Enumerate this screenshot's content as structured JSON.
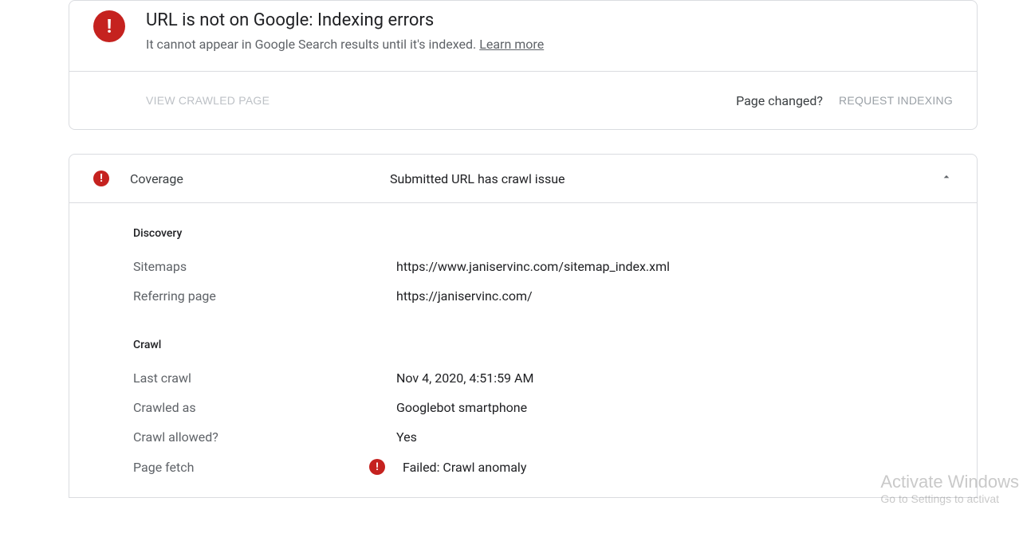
{
  "status": {
    "title": "URL is not on Google: Indexing errors",
    "description": "It cannot appear in Google Search results until it's indexed.",
    "learn_more": "Learn more"
  },
  "actions": {
    "view_crawled": "VIEW CRAWLED PAGE",
    "page_changed": "Page changed?",
    "request_indexing": "REQUEST INDEXING"
  },
  "coverage": {
    "label": "Coverage",
    "value": "Submitted URL has crawl issue"
  },
  "discovery": {
    "section_title": "Discovery",
    "sitemaps_label": "Sitemaps",
    "sitemaps_value": "https://www.janiservinc.com/sitemap_index.xml",
    "referring_label": "Referring page",
    "referring_value": "https://janiservinc.com/"
  },
  "crawl": {
    "section_title": "Crawl",
    "last_crawl_label": "Last crawl",
    "last_crawl_value": "Nov 4, 2020, 4:51:59 AM",
    "crawled_as_label": "Crawled as",
    "crawled_as_value": "Googlebot smartphone",
    "crawl_allowed_label": "Crawl allowed?",
    "crawl_allowed_value": "Yes",
    "page_fetch_label": "Page fetch",
    "page_fetch_value": "Failed: Crawl anomaly"
  },
  "watermark": {
    "line1": "Activate Windows",
    "line2": "Go to Settings to activat"
  }
}
